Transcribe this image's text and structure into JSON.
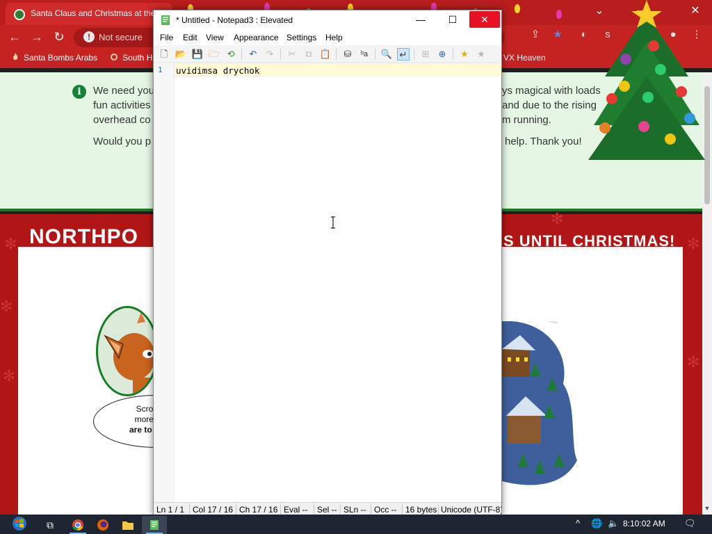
{
  "browser": {
    "tab_title": "Santa Claus and Christmas at the",
    "not_secure_label": "Not secure",
    "bookmarks": [
      {
        "label": "Santa Bombs Arabs"
      },
      {
        "label": "South H"
      },
      {
        "label": "VX Heaven"
      }
    ]
  },
  "page": {
    "notice": {
      "line1_left": "We need you",
      "line1_right": "ys magical with loads",
      "line2_left": "fun activities",
      "line2_right": "and due to the rising",
      "line3_left": "overhead co",
      "line3_right": "m running.",
      "line4_left": "Would you p",
      "line4_right": "help. Thank you!"
    },
    "banner_left": "NORTHPO",
    "banner_right": "S UNTIL CHRISTMAS!",
    "bubble_lines": [
      "Scroll over",
      "more about",
      "are to do at S"
    ]
  },
  "notepad": {
    "title": "* Untitled - Notepad3 : Elevated",
    "menu": [
      "File",
      "Edit",
      "View",
      "Appearance",
      "Settings",
      "Help"
    ],
    "line_number": "1",
    "content": "uvidimsa drychok",
    "status": {
      "ln": "Ln  1 / 1",
      "col": "Col  17 / 16",
      "ch": "Ch  17 / 16",
      "eval": "Eval  --",
      "sel": "Sel  --",
      "sln": "SLn  --",
      "occ": "Occ  --",
      "size": "16 bytes",
      "encoding": "Unicode (UTF-8)"
    }
  },
  "taskbar": {
    "clock": "8:10:02 AM"
  },
  "colors": {
    "accent_red": "#c52222",
    "notice_green": "#e5f6e5",
    "close_red": "#e81123",
    "current_line": "#fffbd6"
  }
}
